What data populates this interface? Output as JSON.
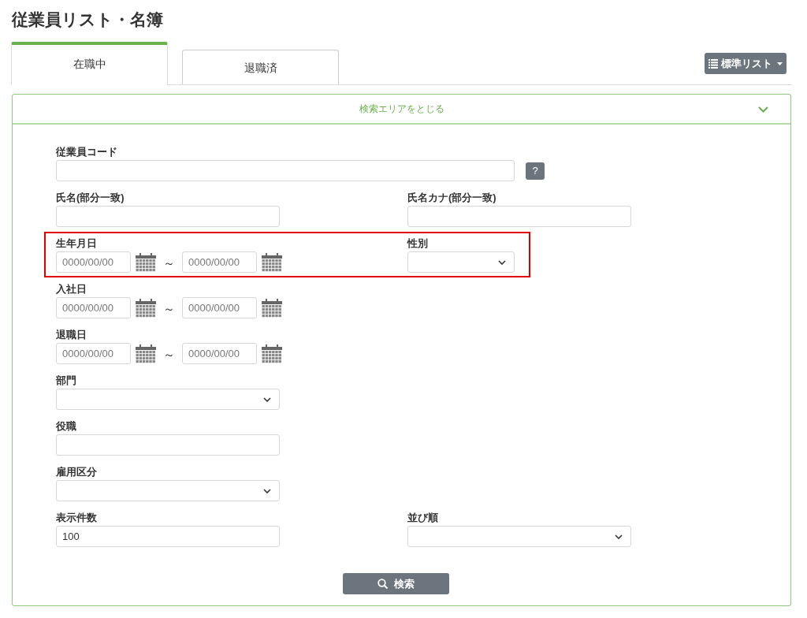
{
  "page_title": "従業員リスト・名簿",
  "tabs": [
    {
      "label": "在職中",
      "selected": true
    },
    {
      "label": "退職済",
      "selected": false
    }
  ],
  "list_menu": {
    "label": "標準リスト"
  },
  "search_panel": {
    "toggle_label": "検索エリアをとじる",
    "expanded": true,
    "rows": [
      {
        "highlighted": false,
        "fields": [
          {
            "kind": "text_help",
            "label": "従業員コード",
            "help": "?"
          }
        ]
      },
      {
        "highlighted": false,
        "fields": [
          {
            "kind": "text",
            "label": "氏名(部分一致)"
          },
          {
            "kind": "text",
            "label": "氏名カナ(部分一致)"
          }
        ]
      },
      {
        "highlighted": true,
        "fields": [
          {
            "kind": "date_range",
            "label": "生年月日",
            "from": {
              "placeholder": "0000/00/00"
            },
            "separator": "～",
            "to": {
              "placeholder": "0000/00/00"
            }
          },
          {
            "kind": "select_short",
            "label": "性別"
          }
        ]
      },
      {
        "highlighted": false,
        "fields": [
          {
            "kind": "date_range",
            "label": "入社日",
            "from": {
              "placeholder": "0000/00/00"
            },
            "separator": "～",
            "to": {
              "placeholder": "0000/00/00"
            }
          }
        ]
      },
      {
        "highlighted": false,
        "fields": [
          {
            "kind": "date_range",
            "label": "退職日",
            "from": {
              "placeholder": "0000/00/00"
            },
            "separator": "～",
            "to": {
              "placeholder": "0000/00/00"
            }
          }
        ]
      },
      {
        "highlighted": false,
        "fields": [
          {
            "kind": "select",
            "label": "部門"
          }
        ]
      },
      {
        "highlighted": false,
        "fields": [
          {
            "kind": "text",
            "label": "役職"
          }
        ]
      },
      {
        "highlighted": false,
        "fields": [
          {
            "kind": "select",
            "label": "雇用区分"
          }
        ]
      },
      {
        "highlighted": false,
        "fields": [
          {
            "kind": "text",
            "label": "表示件数",
            "value": "100"
          },
          {
            "kind": "select",
            "label": "並び順"
          }
        ]
      }
    ],
    "search_button": "検索"
  }
}
